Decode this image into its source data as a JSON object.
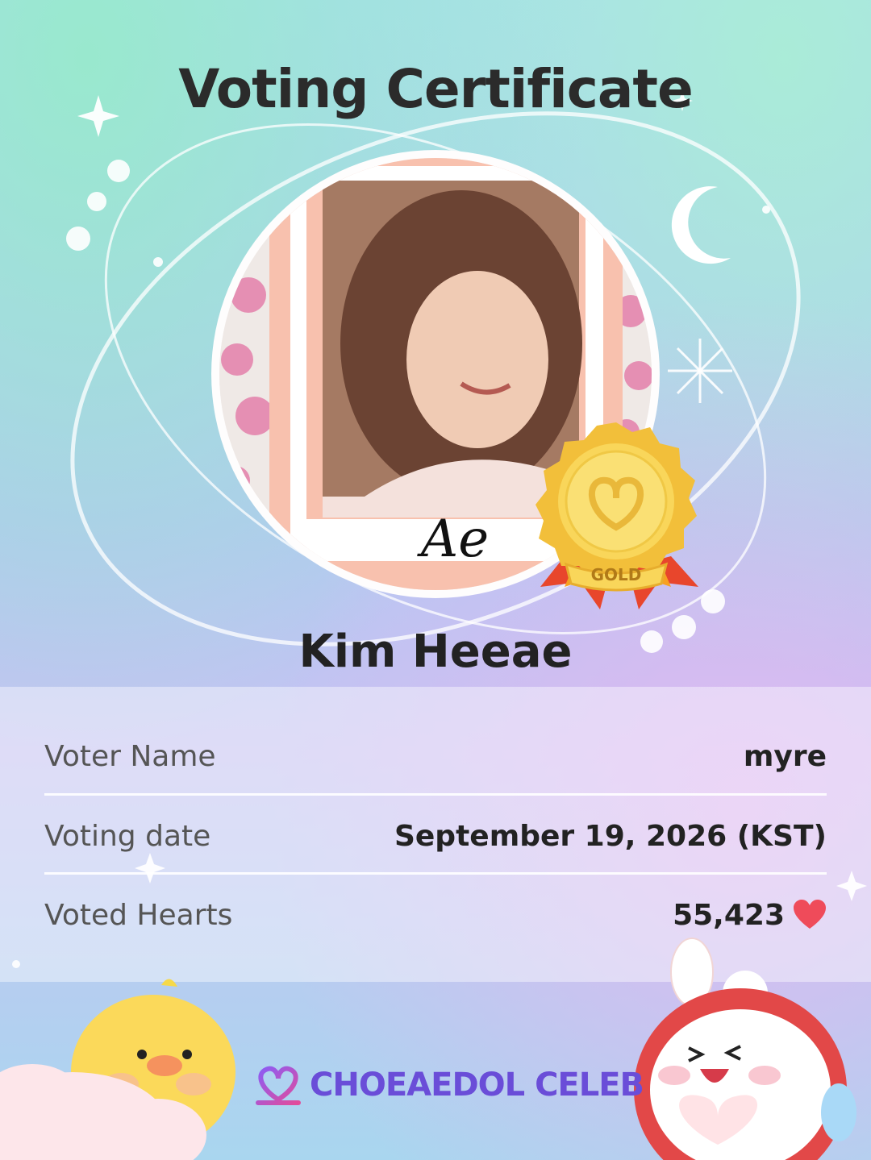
{
  "certificate": {
    "title": "Voting Certificate",
    "celeb_name": "Kim Heeae",
    "signature": "Ae",
    "medal_label": "GOLD"
  },
  "details": {
    "voter_name_label": "Voter Name",
    "voter_name_value": "myre",
    "voting_date_label": "Voting date",
    "voting_date_value": "September 19, 2026 (KST)",
    "voted_hearts_label": "Voted Hearts",
    "voted_hearts_value": "55,423",
    "heart_icon": "heart-icon"
  },
  "brand": {
    "name": "CHOEAEDOL CELEB",
    "logo_icon": "choeaedol-heart-logo-icon"
  },
  "colors": {
    "title_text": "#2b2b2b",
    "brand_purple": "#6a4dd8",
    "heart_red": "#ef4b5a",
    "frame_peach": "#f8c1ae",
    "medal_gold": "#f6c544"
  }
}
